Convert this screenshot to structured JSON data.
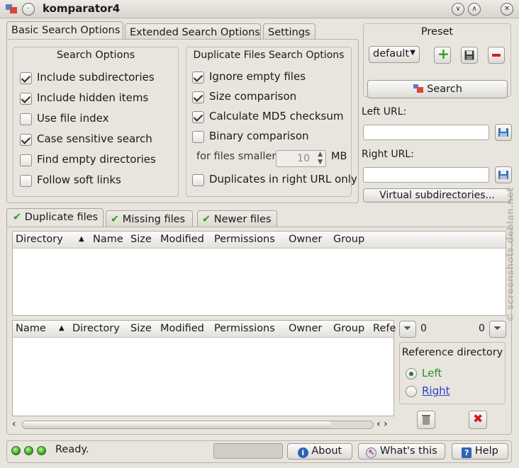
{
  "window": {
    "title": "komparator4"
  },
  "tabs": [
    "Basic Search Options",
    "Extended Search Options",
    "Settings"
  ],
  "search_options": {
    "title": "Search Options",
    "items": [
      {
        "label": "Include subdirectories",
        "checked": true
      },
      {
        "label": "Include hidden items",
        "checked": true
      },
      {
        "label": "Use file index",
        "checked": false
      },
      {
        "label": "Case sensitive search",
        "checked": true
      },
      {
        "label": "Find empty directories",
        "checked": false
      },
      {
        "label": "Follow soft links",
        "checked": false
      }
    ]
  },
  "dup_options": {
    "title": "Duplicate Files Search Options",
    "items": [
      {
        "label": "Ignore empty files",
        "checked": true
      },
      {
        "label": "Size comparison",
        "checked": true
      },
      {
        "label": "Calculate MD5 checksum",
        "checked": true
      },
      {
        "label": "Binary comparison",
        "checked": false
      }
    ],
    "smaller_label": "for files smaller",
    "smaller_value": "10",
    "smaller_unit": "MB",
    "dup_right": {
      "label": "Duplicates in right URL only",
      "checked": false
    }
  },
  "preset": {
    "title": "Preset",
    "selected": "default"
  },
  "search_label": "Search",
  "left_url_label": "Left URL:",
  "left_url_value": "",
  "right_url_label": "Right URL:",
  "right_url_value": "",
  "virtual_label": "Virtual subdirectories...",
  "result_tabs": [
    "Duplicate files",
    "Missing files",
    "Newer files"
  ],
  "upper_columns": [
    "Directory",
    "Name",
    "Size",
    "Modified",
    "Permissions",
    "Owner",
    "Group"
  ],
  "lower_columns": [
    "Name",
    "Directory",
    "Size",
    "Modified",
    "Permissions",
    "Owner",
    "Group",
    "Refe"
  ],
  "filter_left_count": "0",
  "filter_right_count": "0",
  "reference": {
    "title": "Reference directory",
    "left": "Left",
    "right": "Right",
    "selected": "Left"
  },
  "status": {
    "text": "Ready."
  },
  "buttons": {
    "about": "About",
    "whats_this": "What's this",
    "help": "Help"
  },
  "watermark": "© screenshots.debian.net",
  "colors": {
    "background": "#e8e5df",
    "accent_green": "#2f9d1a",
    "radio_left_text": "#2f8f2f",
    "radio_right_text": "#2a3fc7",
    "delete_red": "#cc1b1b"
  }
}
